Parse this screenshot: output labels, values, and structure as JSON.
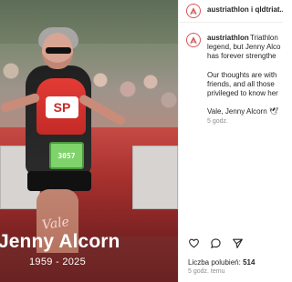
{
  "header": {
    "account": "austriathlon i qldtriat..."
  },
  "memorial_image": {
    "vale_text": "Vale",
    "name": "Jenny Alcorn",
    "years": "1959 - 2025",
    "bib_number": "3057",
    "jersey_logo": "SP"
  },
  "post": {
    "caption_account": "austriathlon",
    "caption_line_1": "Triathlon",
    "caption_line_2": "legend, but Jenny Alco",
    "caption_line_3": "has forever strengthe",
    "caption_line_4": "Our thoughts are with",
    "caption_line_5": "friends, and all those",
    "caption_line_6": "privileged to know her",
    "caption_line_7": "Vale, Jenny Alcorn 🕊",
    "caption_time": "5 godz."
  },
  "actions": {
    "like_icon": "heart-icon",
    "comment_icon": "comment-icon",
    "share_icon": "send-icon"
  },
  "engagement": {
    "likes_label": "Liczba polubień:",
    "likes_count": "514",
    "post_time": "5 godz. temu"
  },
  "colors": {
    "brand_red": "#d85757",
    "text_dark": "#262626",
    "text_muted": "#8e8e8e",
    "photo_red": "#c42a27",
    "photo_text": "#ffffff"
  }
}
